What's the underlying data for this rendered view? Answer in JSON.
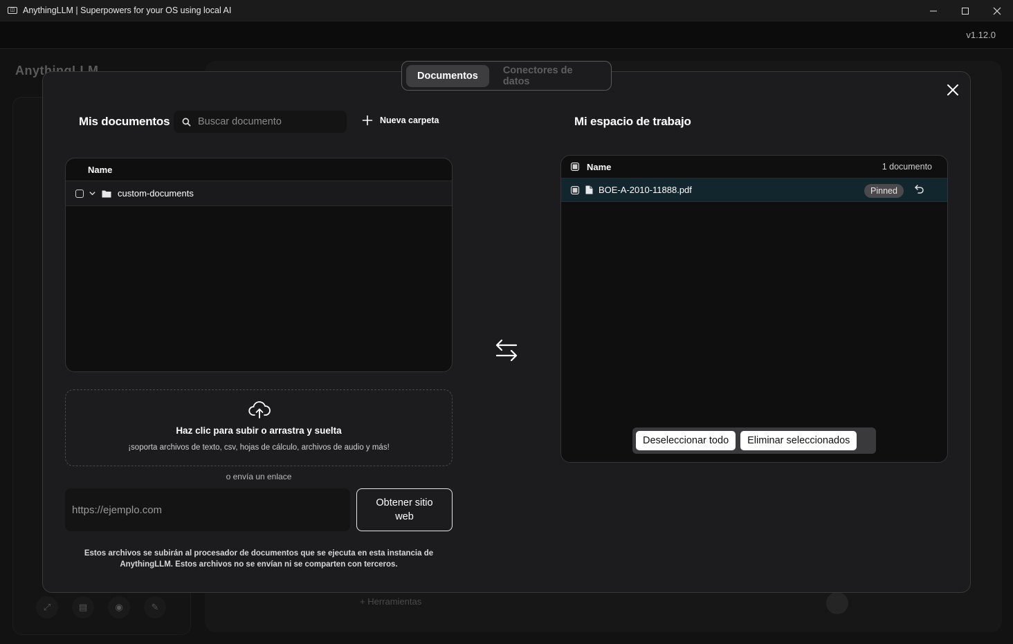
{
  "window": {
    "title": "AnythingLLM | Superpowers for your OS using local AI",
    "icon_label": "◫",
    "version": "v1.12.0"
  },
  "background": {
    "logo": "AnythingLLM",
    "tools_label": "Herramientas"
  },
  "modal": {
    "tabs": [
      {
        "label": "Documentos",
        "active": true
      },
      {
        "label": "Conectores de datos",
        "active": false
      }
    ],
    "left": {
      "title": "Mis documentos",
      "search_placeholder": "Buscar documento",
      "new_folder_label": "Nueva carpeta",
      "column_name": "Name",
      "folders": [
        {
          "name": "custom-documents"
        }
      ],
      "upload": {
        "title": "Haz clic para subir o arrastra y suelta",
        "subtitle": "¡soporta archivos de texto, csv, hojas de cálculo, archivos de audio y más!"
      },
      "or_link": "o envía un enlace",
      "url_placeholder": "https://ejemplo.com",
      "fetch_label": "Obtener sitio web",
      "disclaimer": "Estos archivos se subirán al procesador de documentos que se ejecuta en esta instancia de AnythingLLM. Estos archivos no se envían ni se comparten con terceros."
    },
    "right": {
      "title": "Mi espacio de trabajo",
      "column_name": "Name",
      "count_label": "1 documento",
      "files": [
        {
          "name": "BOE-A-2010-11888.pdf",
          "badge": "Pinned"
        }
      ],
      "deselect_label": "Deseleccionar todo",
      "delete_label": "Eliminar seleccionados"
    }
  },
  "colors": {
    "modal_bg": "#1c1c1e",
    "panel_bg": "#0f0f0f",
    "selected_row": "#12262e",
    "active_tab": "#3d3d40"
  }
}
